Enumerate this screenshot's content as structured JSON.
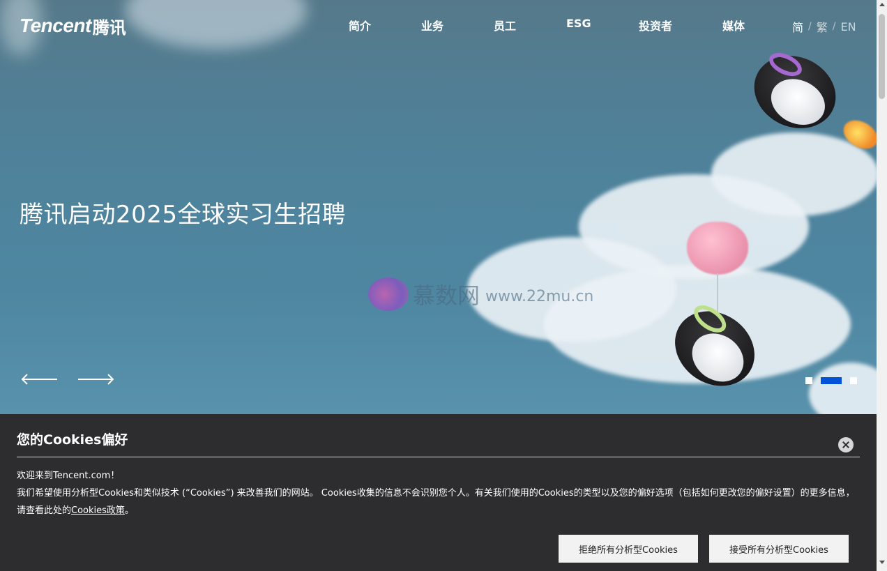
{
  "header": {
    "logo_en": "Tencent",
    "logo_cn": "腾讯",
    "nav": [
      {
        "label": "简介"
      },
      {
        "label": "业务"
      },
      {
        "label": "员工"
      },
      {
        "label": "ESG"
      },
      {
        "label": "投资者"
      },
      {
        "label": "媒体"
      }
    ],
    "languages": [
      {
        "label": "简",
        "active": true
      },
      {
        "label": "繁",
        "active": false
      },
      {
        "label": "EN",
        "active": false
      }
    ],
    "lang_separator": "/"
  },
  "hero": {
    "headline": "腾讯启动2025全球实习生招聘",
    "carousel": {
      "slide_count": 3,
      "active_index": 1
    }
  },
  "watermark": {
    "cn": "慕数网",
    "url": "www.22mu.cn"
  },
  "cookie_banner": {
    "title": "您的Cookies偏好",
    "welcome": "欢迎来到Tencent.com！",
    "body": "我们希望使用分析型Cookies和类似技术 (“Cookies”) 来改善我们的网站。 Cookies收集的信息不会识别您个人。有关我们使用的Cookies的类型以及您的偏好选项（包括如何更改您的偏好设置）的更多信息，请查看此处的",
    "policy_link": "Cookies政策",
    "body_end": "。",
    "reject_label": "拒绝所有分析型Cookies",
    "accept_label": "接受所有分析型Cookies"
  },
  "colors": {
    "cookie_bg": "#2d2d30",
    "active_dot": "#0052d9",
    "button_bg": "#f2f2f2"
  }
}
